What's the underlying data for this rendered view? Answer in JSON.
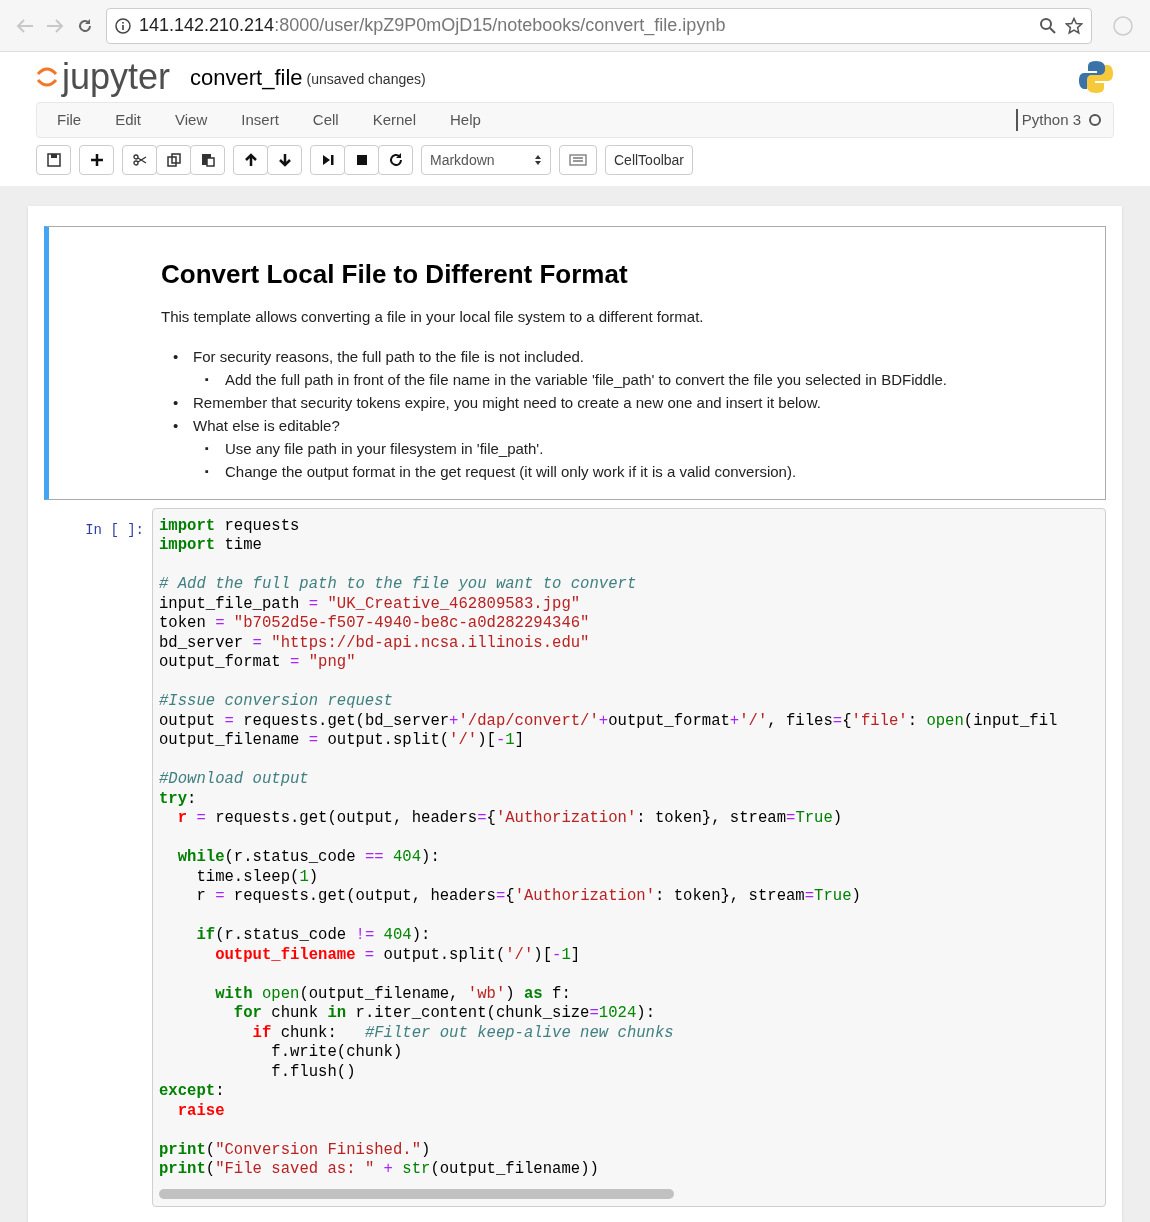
{
  "browser": {
    "url_host": "141.142.210.214",
    "url_path": ":8000/user/kpZ9P0mOjD15/notebooks/convert_file.ipynb"
  },
  "header": {
    "logo_text": "jupyter",
    "notebook_name": "convert_file",
    "save_status": "(unsaved changes)"
  },
  "menu": [
    "File",
    "Edit",
    "View",
    "Insert",
    "Cell",
    "Kernel",
    "Help"
  ],
  "kernel": {
    "name": "Python 3",
    "busy": false
  },
  "toolbar": {
    "groups": [
      {
        "buttons": [
          {
            "kind": "save"
          }
        ]
      },
      {
        "buttons": [
          {
            "kind": "add"
          }
        ]
      },
      {
        "buttons": [
          {
            "kind": "cut"
          },
          {
            "kind": "copy"
          },
          {
            "kind": "paste"
          }
        ]
      },
      {
        "buttons": [
          {
            "kind": "up"
          },
          {
            "kind": "down"
          }
        ]
      },
      {
        "buttons": [
          {
            "kind": "run"
          },
          {
            "kind": "stop"
          },
          {
            "kind": "restart"
          }
        ]
      }
    ],
    "cell_type": "Markdown",
    "cell_toolbar": "CellToolbar"
  },
  "markdown_cell": {
    "selected": true,
    "heading": "Convert Local File to Different Format",
    "intro": "This template allows converting a file in your local file system to a different format.",
    "bullets": [
      {
        "marker": "•",
        "text": "For security reasons, the full path to the file is not included.",
        "children": [
          {
            "marker": "▪",
            "text": "Add the full path in front of the file name in the variable 'file_path' to convert the file you selected in BDFiddle."
          }
        ]
      },
      {
        "marker": "•",
        "text": "Remember that security tokens expire, you might need to create a new one and insert it below."
      },
      {
        "marker": "•",
        "text": "What else is editable?",
        "children": [
          {
            "marker": "▪",
            "text": "Use any file path in your filesystem in 'file_path'."
          },
          {
            "marker": "▪",
            "text": "Change the output format in the get request (it will only work if it is a valid conversion)."
          }
        ]
      }
    ]
  },
  "code_cell": {
    "prompt": "In [ ]:",
    "lines": [
      {
        "kind": "code",
        "tokens": [
          {
            "kind": "k",
            "text": "import"
          },
          {
            "kind": "p",
            "text": " requests"
          }
        ]
      },
      {
        "kind": "code",
        "tokens": [
          {
            "kind": "k",
            "text": "import"
          },
          {
            "kind": "p",
            "text": " time"
          }
        ]
      },
      {
        "kind": "blank"
      },
      {
        "kind": "code",
        "tokens": [
          {
            "kind": "c",
            "text": "# Add the full path to the file you want to convert"
          }
        ]
      },
      {
        "kind": "code",
        "tokens": [
          {
            "kind": "p",
            "text": "input_file_path "
          },
          {
            "kind": "o",
            "text": "="
          },
          {
            "kind": "s",
            "text": " \"UK_Creative_462809583.jpg\""
          }
        ]
      },
      {
        "kind": "code",
        "tokens": [
          {
            "kind": "p",
            "text": "token "
          },
          {
            "kind": "o",
            "text": "="
          },
          {
            "kind": "s",
            "text": " \"b7052d5e-f507-4940-be8c-a0d282294346\""
          }
        ]
      },
      {
        "kind": "code",
        "tokens": [
          {
            "kind": "p",
            "text": "bd_server "
          },
          {
            "kind": "o",
            "text": "="
          },
          {
            "kind": "s",
            "text": " \"https://bd-api.ncsa.illinois.edu\""
          }
        ]
      },
      {
        "kind": "code",
        "tokens": [
          {
            "kind": "p",
            "text": "output_format "
          },
          {
            "kind": "o",
            "text": "="
          },
          {
            "kind": "s",
            "text": " \"png\""
          }
        ]
      },
      {
        "kind": "blank"
      },
      {
        "kind": "code",
        "tokens": [
          {
            "kind": "c",
            "text": "#Issue conversion request"
          }
        ]
      },
      {
        "kind": "code",
        "tokens": [
          {
            "kind": "p",
            "text": "output "
          },
          {
            "kind": "o",
            "text": "="
          },
          {
            "kind": "p",
            "text": " requests.get(bd_server"
          },
          {
            "kind": "o",
            "text": "+"
          },
          {
            "kind": "s",
            "text": "'/dap/convert/'"
          },
          {
            "kind": "o",
            "text": "+"
          },
          {
            "kind": "p",
            "text": "output_format"
          },
          {
            "kind": "o",
            "text": "+"
          },
          {
            "kind": "s",
            "text": "'/'"
          },
          {
            "kind": "p",
            "text": ", files"
          },
          {
            "kind": "o",
            "text": "="
          },
          {
            "kind": "p",
            "text": "{"
          },
          {
            "kind": "s",
            "text": "'file'"
          },
          {
            "kind": "p",
            "text": ": "
          },
          {
            "kind": "b",
            "text": "open"
          },
          {
            "kind": "p",
            "text": "(input_fil"
          }
        ]
      },
      {
        "kind": "code",
        "tokens": [
          {
            "kind": "p",
            "text": "output_filename "
          },
          {
            "kind": "o",
            "text": "="
          },
          {
            "kind": "p",
            "text": " output.split("
          },
          {
            "kind": "s",
            "text": "'/'"
          },
          {
            "kind": "p",
            "text": ")["
          },
          {
            "kind": "o",
            "text": "-"
          },
          {
            "kind": "n",
            "text": "1"
          },
          {
            "kind": "p",
            "text": "]"
          }
        ]
      },
      {
        "kind": "blank"
      },
      {
        "kind": "code",
        "tokens": [
          {
            "kind": "c",
            "text": "#Download output"
          }
        ]
      },
      {
        "kind": "code",
        "tokens": [
          {
            "kind": "k",
            "text": "try"
          },
          {
            "kind": "p",
            "text": ":"
          }
        ]
      },
      {
        "kind": "code",
        "tokens": [
          {
            "kind": "v",
            "text": "  r"
          },
          {
            "kind": "o",
            "text": " ="
          },
          {
            "kind": "p",
            "text": " requests.get(output, headers"
          },
          {
            "kind": "o",
            "text": "="
          },
          {
            "kind": "p",
            "text": "{"
          },
          {
            "kind": "s",
            "text": "'Authorization'"
          },
          {
            "kind": "p",
            "text": ": token}, stream"
          },
          {
            "kind": "o",
            "text": "="
          },
          {
            "kind": "b",
            "text": "True"
          },
          {
            "kind": "p",
            "text": ")"
          }
        ]
      },
      {
        "kind": "blank"
      },
      {
        "kind": "code",
        "tokens": [
          {
            "kind": "k",
            "text": "  while"
          },
          {
            "kind": "p",
            "text": "(r.status_code "
          },
          {
            "kind": "o",
            "text": "=="
          },
          {
            "kind": "n",
            "text": " 404"
          },
          {
            "kind": "p",
            "text": "):"
          }
        ]
      },
      {
        "kind": "code",
        "tokens": [
          {
            "kind": "p",
            "text": "    time.sleep("
          },
          {
            "kind": "n",
            "text": "1"
          },
          {
            "kind": "p",
            "text": ")"
          }
        ]
      },
      {
        "kind": "code",
        "tokens": [
          {
            "kind": "p",
            "text": "    r "
          },
          {
            "kind": "o",
            "text": "="
          },
          {
            "kind": "p",
            "text": " requests.get(output, headers"
          },
          {
            "kind": "o",
            "text": "="
          },
          {
            "kind": "p",
            "text": "{"
          },
          {
            "kind": "s",
            "text": "'Authorization'"
          },
          {
            "kind": "p",
            "text": ": token}, stream"
          },
          {
            "kind": "o",
            "text": "="
          },
          {
            "kind": "b",
            "text": "True"
          },
          {
            "kind": "p",
            "text": ")"
          }
        ]
      },
      {
        "kind": "blank"
      },
      {
        "kind": "code",
        "tokens": [
          {
            "kind": "k",
            "text": "    if"
          },
          {
            "kind": "p",
            "text": "(r.status_code "
          },
          {
            "kind": "o",
            "text": "!="
          },
          {
            "kind": "n",
            "text": " 404"
          },
          {
            "kind": "p",
            "text": "):"
          }
        ]
      },
      {
        "kind": "code",
        "tokens": [
          {
            "kind": "v",
            "text": "      output_filename"
          },
          {
            "kind": "o",
            "text": " ="
          },
          {
            "kind": "p",
            "text": " output.split("
          },
          {
            "kind": "s",
            "text": "'/'"
          },
          {
            "kind": "p",
            "text": ")["
          },
          {
            "kind": "o",
            "text": "-"
          },
          {
            "kind": "n",
            "text": "1"
          },
          {
            "kind": "p",
            "text": "]"
          }
        ]
      },
      {
        "kind": "blank"
      },
      {
        "kind": "code",
        "tokens": [
          {
            "kind": "k",
            "text": "      with"
          },
          {
            "kind": "b",
            "text": " open"
          },
          {
            "kind": "p",
            "text": "(output_filename, "
          },
          {
            "kind": "s",
            "text": "'wb'"
          },
          {
            "kind": "p",
            "text": ") "
          },
          {
            "kind": "k",
            "text": "as"
          },
          {
            "kind": "p",
            "text": " f:"
          }
        ]
      },
      {
        "kind": "code",
        "tokens": [
          {
            "kind": "k",
            "text": "        for"
          },
          {
            "kind": "p",
            "text": " chunk "
          },
          {
            "kind": "k",
            "text": "in"
          },
          {
            "kind": "p",
            "text": " r.iter_content(chunk_size"
          },
          {
            "kind": "o",
            "text": "="
          },
          {
            "kind": "n",
            "text": "1024"
          },
          {
            "kind": "p",
            "text": "):"
          }
        ]
      },
      {
        "kind": "code",
        "tokens": [
          {
            "kind": "v",
            "text": "          if"
          },
          {
            "kind": "p",
            "text": " chunk:   "
          },
          {
            "kind": "c",
            "text": "#Filter out keep-alive new chunks"
          }
        ]
      },
      {
        "kind": "code",
        "tokens": [
          {
            "kind": "p",
            "text": "            f.write(chunk)"
          }
        ]
      },
      {
        "kind": "code",
        "tokens": [
          {
            "kind": "p",
            "text": "            f.flush()"
          }
        ]
      },
      {
        "kind": "code",
        "tokens": [
          {
            "kind": "k",
            "text": "except"
          },
          {
            "kind": "p",
            "text": ":"
          }
        ]
      },
      {
        "kind": "code",
        "tokens": [
          {
            "kind": "v",
            "text": "  raise"
          }
        ]
      },
      {
        "kind": "blank"
      },
      {
        "kind": "code",
        "tokens": [
          {
            "kind": "k",
            "text": "print"
          },
          {
            "kind": "p",
            "text": "("
          },
          {
            "kind": "s",
            "text": "\"Conversion Finished.\""
          },
          {
            "kind": "p",
            "text": ")"
          }
        ]
      },
      {
        "kind": "code",
        "tokens": [
          {
            "kind": "k",
            "text": "print"
          },
          {
            "kind": "p",
            "text": "("
          },
          {
            "kind": "s",
            "text": "\"File saved as: \""
          },
          {
            "kind": "o",
            "text": " + "
          },
          {
            "kind": "b",
            "text": "str"
          },
          {
            "kind": "p",
            "text": "(output_filename))"
          }
        ]
      }
    ]
  }
}
